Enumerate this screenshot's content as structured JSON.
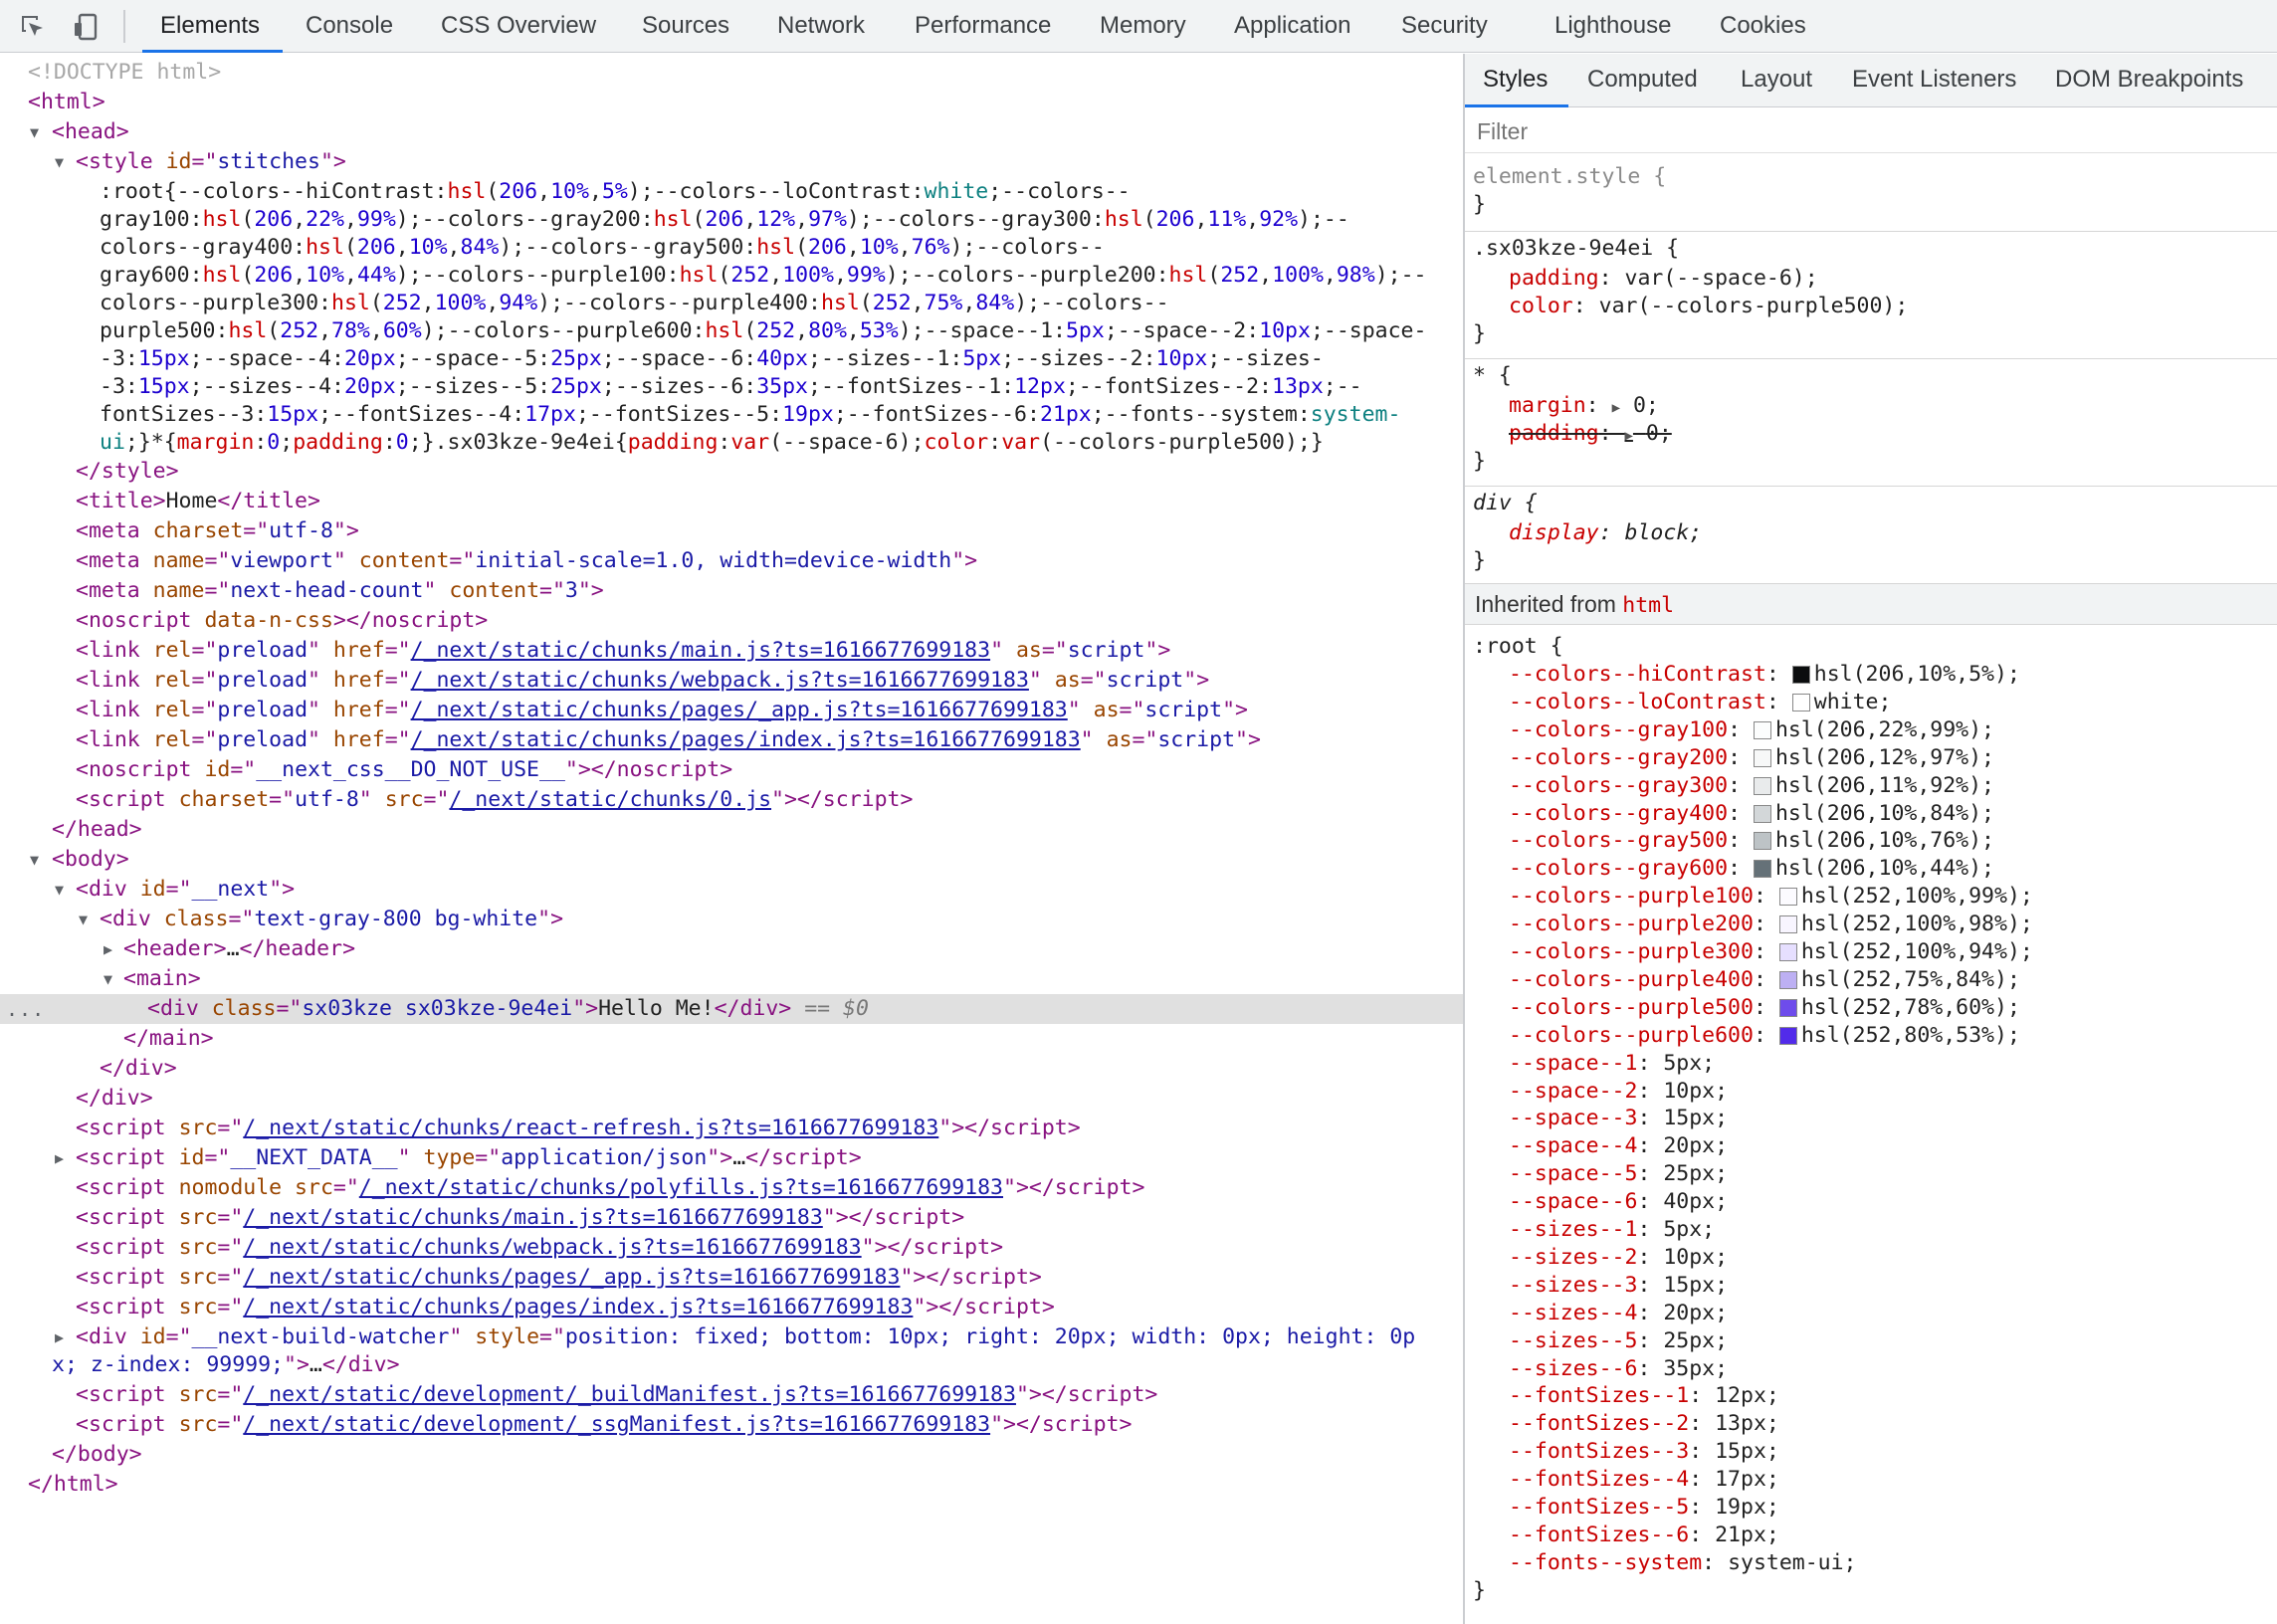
{
  "toolbar": {
    "tabs": [
      "Elements",
      "Console",
      "CSS Overview",
      "Sources",
      "Network",
      "Performance",
      "Memory",
      "Application",
      "Security",
      "Lighthouse",
      "Cookies"
    ],
    "active_tab": "Elements",
    "icons": [
      "inspect-element-icon",
      "device-toolbar-icon"
    ]
  },
  "dom": {
    "doctype": "<!DOCTYPE html>",
    "style_css_1": ":root{--colors--hiContrast:",
    "lines": {
      "title_text": "Home",
      "selected_text": "Hello Me!",
      "selected_marker": "== $0",
      "ellipsis": "…",
      "more_dots": "..."
    },
    "links": {
      "main_js": "/_next/static/chunks/main.js?ts=1616677699183",
      "webpack_js": "/_next/static/chunks/webpack.js?ts=1616677699183",
      "app_js": "/_next/static/chunks/pages/_app.js?ts=1616677699183",
      "index_js": "/_next/static/chunks/pages/index.js?ts=1616677699183",
      "zero_js": "/_next/static/chunks/0.js",
      "react_refresh_js": "/_next/static/chunks/react-refresh.js?ts=1616677699183",
      "polyfills_js": "/_next/static/chunks/polyfills.js?ts=1616677699183",
      "build_manifest_js": "/_next/static/development/_buildManifest.js?ts=1616677699183",
      "ssg_manifest_js": "/_next/static/development/_ssgManifest.js?ts=1616677699183"
    }
  },
  "styles_pane": {
    "tabs": [
      "Styles",
      "Computed",
      "Layout",
      "Event Listeners",
      "DOM Breakpoints"
    ],
    "active_tab": "Styles",
    "filter_placeholder": "Filter",
    "element_style": "element.style {",
    "rule1_selector": ".sx03kze-9e4ei {",
    "rule1_props": [
      {
        "name": "padding",
        "value": "var(--space-6);"
      },
      {
        "name": "color",
        "value": "var(--colors-purple500);"
      }
    ],
    "rule2_selector": "* {",
    "rule2_props": [
      {
        "name": "margin",
        "value": "0;"
      },
      {
        "name": "padding",
        "value": "0;"
      }
    ],
    "rule3_selector": "div {",
    "rule3_props": [
      {
        "name": "display",
        "value": "block;"
      }
    ],
    "inherited_label": "Inherited from",
    "inherited_from": "html",
    "root_selector": ":root {",
    "root_vars": [
      {
        "name": "--colors--hiContrast",
        "value": "hsl(206,10%,5%);",
        "swatch": "#0b0d0e"
      },
      {
        "name": "--colors--loContrast",
        "value": "white;",
        "swatch": "#ffffff"
      },
      {
        "name": "--colors--gray100",
        "value": "hsl(206,22%,99%);",
        "swatch": "#fcfdfd"
      },
      {
        "name": "--colors--gray200",
        "value": "hsl(206,12%,97%);",
        "swatch": "#f7f8f8"
      },
      {
        "name": "--colors--gray300",
        "value": "hsl(206,11%,92%);",
        "swatch": "#e9ebec"
      },
      {
        "name": "--colors--gray400",
        "value": "hsl(206,10%,84%);",
        "swatch": "#d3d7d9"
      },
      {
        "name": "--colors--gray500",
        "value": "hsl(206,10%,76%);",
        "swatch": "#bdc3c6"
      },
      {
        "name": "--colors--gray600",
        "value": "hsl(206,10%,44%);",
        "swatch": "#657178"
      },
      {
        "name": "--colors--purple100",
        "value": "hsl(252,100%,99%);",
        "swatch": "#fcfbff"
      },
      {
        "name": "--colors--purple200",
        "value": "hsl(252,100%,98%);",
        "swatch": "#f8f5ff"
      },
      {
        "name": "--colors--purple300",
        "value": "hsl(252,100%,94%);",
        "swatch": "#e6dfff"
      },
      {
        "name": "--colors--purple400",
        "value": "hsl(252,75%,84%);",
        "swatch": "#bdb0f3"
      },
      {
        "name": "--colors--purple500",
        "value": "hsl(252,78%,60%);",
        "swatch": "#6e4ceb"
      },
      {
        "name": "--colors--purple600",
        "value": "hsl(252,80%,53%);",
        "swatch": "#522bea"
      },
      {
        "name": "--space--1",
        "value": "5px;"
      },
      {
        "name": "--space--2",
        "value": "10px;"
      },
      {
        "name": "--space--3",
        "value": "15px;"
      },
      {
        "name": "--space--4",
        "value": "20px;"
      },
      {
        "name": "--space--5",
        "value": "25px;"
      },
      {
        "name": "--space--6",
        "value": "40px;"
      },
      {
        "name": "--sizes--1",
        "value": "5px;"
      },
      {
        "name": "--sizes--2",
        "value": "10px;"
      },
      {
        "name": "--sizes--3",
        "value": "15px;"
      },
      {
        "name": "--sizes--4",
        "value": "20px;"
      },
      {
        "name": "--sizes--5",
        "value": "25px;"
      },
      {
        "name": "--sizes--6",
        "value": "35px;"
      },
      {
        "name": "--fontSizes--1",
        "value": "12px;"
      },
      {
        "name": "--fontSizes--2",
        "value": "13px;"
      },
      {
        "name": "--fontSizes--3",
        "value": "15px;"
      },
      {
        "name": "--fontSizes--4",
        "value": "17px;"
      },
      {
        "name": "--fontSizes--5",
        "value": "19px;"
      },
      {
        "name": "--fontSizes--6",
        "value": "21px;"
      },
      {
        "name": "--fonts--system",
        "value": "system-ui;"
      }
    ]
  },
  "colors": {
    "accent": "#1a73e8",
    "tag": "#881280",
    "attr_name": "#994500",
    "attr_value": "#1a1aa6",
    "css_prop": "#c80000"
  }
}
